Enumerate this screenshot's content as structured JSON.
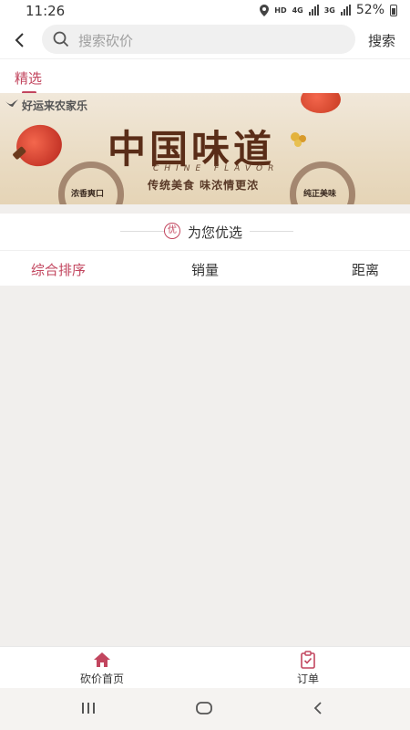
{
  "status": {
    "time": "11:26",
    "hd": "HD",
    "net": "4G",
    "signal2": "3G",
    "battery": "52%"
  },
  "header": {
    "search_placeholder": "搜索砍价",
    "search_button": "搜索"
  },
  "tabs": [
    {
      "label": "精选",
      "active": true
    }
  ],
  "banner": {
    "brand": "好运来农家乐",
    "title_cn": "中国味道",
    "title_en": "CHINE  FLAVOR",
    "slogan": "传统美食  味浓情更浓",
    "stamp_left": "浓香爽口",
    "stamp_right": "纯正美味"
  },
  "section": {
    "badge": "优",
    "title": "为您优选"
  },
  "sort": {
    "items": [
      "综合排序",
      "销量",
      "距离"
    ],
    "active_index": 0
  },
  "bottom_nav": [
    {
      "label": "砍价首页",
      "icon": "home-icon",
      "active": true
    },
    {
      "label": "订单",
      "icon": "order-icon",
      "active": false
    }
  ],
  "colors": {
    "accent": "#c2455e",
    "background": "#f1efed"
  }
}
